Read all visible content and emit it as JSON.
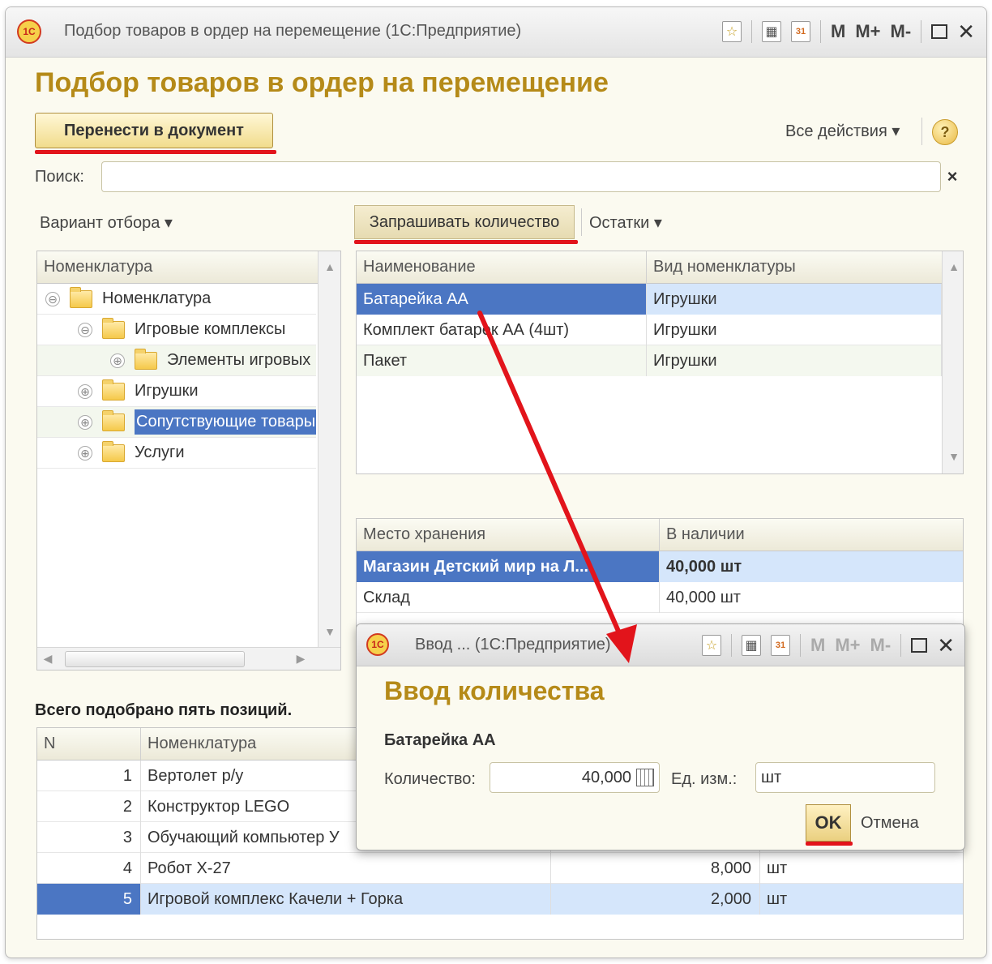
{
  "window": {
    "logo": "1С",
    "title": "Подбор товаров в ордер на перемещение  (1С:Предприятие)",
    "toolbar_icons": [
      "star-icon",
      "calculator-icon",
      "calendar-icon"
    ],
    "calendar_day": "31",
    "memory_buttons": [
      "M",
      "M+",
      "M-"
    ]
  },
  "form": {
    "title": "Подбор товаров в ордер на перемещение",
    "transfer_button": "Перенести в документ",
    "all_actions": "Все действия ▾",
    "help": "?",
    "search_label": "Поиск:",
    "search_value": "",
    "search_clear": "×",
    "filter_variant": "Вариант отбора ▾",
    "ask_quantity": "Запрашивать количество",
    "remains": "Остатки ▾"
  },
  "tree": {
    "header": "Номенклатура",
    "items": [
      {
        "label": "Номенклатура",
        "expander": "⊖"
      },
      {
        "label": "Игровые комплексы",
        "expander": "⊖"
      },
      {
        "label": "Элементы игровых",
        "expander": "⊕"
      },
      {
        "label": "Игрушки",
        "expander": "⊕"
      },
      {
        "label": "Сопутствующие товары",
        "expander": "⊕"
      },
      {
        "label": "Услуги",
        "expander": "⊕"
      }
    ]
  },
  "products": {
    "columns": [
      "Наименование",
      "Вид номенклатуры"
    ],
    "rows": [
      {
        "name": "Батарейка АА",
        "kind": "Игрушки"
      },
      {
        "name": "Комплект батарек АА (4шт)",
        "kind": "Игрушки"
      },
      {
        "name": "Пакет",
        "kind": "Игрушки"
      }
    ]
  },
  "stock": {
    "columns": [
      "Место хранения",
      "В наличии"
    ],
    "rows": [
      {
        "place": "Магазин Детский мир на Л...",
        "qty": "40,000 шт"
      },
      {
        "place": "Склад",
        "qty": "40,000 шт"
      }
    ]
  },
  "summary": "Всего подобрано пять позиций.",
  "selected": {
    "columns": [
      "N",
      "Номенклатура"
    ],
    "rows": [
      {
        "n": "1",
        "name": "Вертолет р/у",
        "qty": "",
        "unit": ""
      },
      {
        "n": "2",
        "name": "Конструктор LEGO",
        "qty": "",
        "unit": ""
      },
      {
        "n": "3",
        "name": "Обучающий компьютер У",
        "qty": "",
        "unit": ""
      },
      {
        "n": "4",
        "name": "Робот Х-27",
        "qty": "8,000",
        "unit": "шт"
      },
      {
        "n": "5",
        "name": "Игровой комплекс Качели + Горка",
        "qty": "2,000",
        "unit": "шт"
      }
    ]
  },
  "dialog": {
    "title": "Ввод ...  (1С:Предприятие)",
    "heading": "Ввод количества",
    "item": "Батарейка АА",
    "qty_label": "Количество:",
    "qty_value": "40,000",
    "unit_label": "Ед. изм.:",
    "unit_value": "шт",
    "ok": "OK",
    "cancel": "Отмена"
  },
  "colors": {
    "accent_title": "#b58a18",
    "highlight": "#e2141b",
    "selection": "#4b76c3"
  }
}
